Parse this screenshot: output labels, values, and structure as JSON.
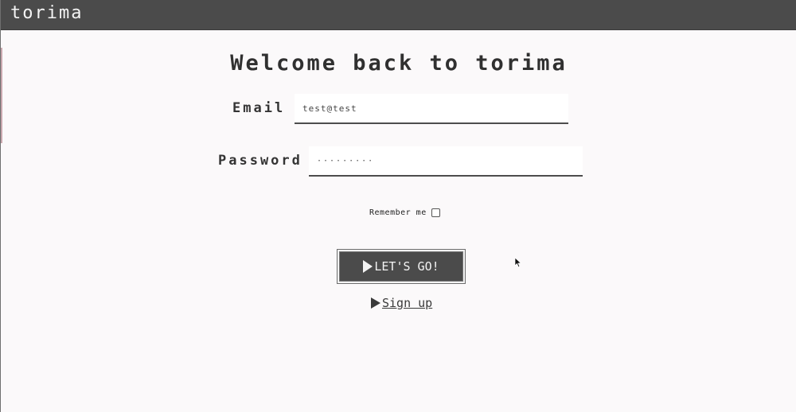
{
  "app": {
    "brand": "torima"
  },
  "login": {
    "title": "Welcome back to torima",
    "email_label": "Email",
    "email_value": "test@test",
    "password_label": "Password",
    "password_value": "·········",
    "remember_label": "Remember me",
    "remember_checked": false,
    "submit_label": "LET'S GO!",
    "signup_label": "Sign up"
  },
  "icons": {
    "submit": "play-icon",
    "signup": "play-icon",
    "pointer": "mouse-cursor-icon"
  },
  "colors": {
    "topbar": "#4b4b4b",
    "background": "#fbf9fa",
    "button": "#4b4b4b"
  }
}
